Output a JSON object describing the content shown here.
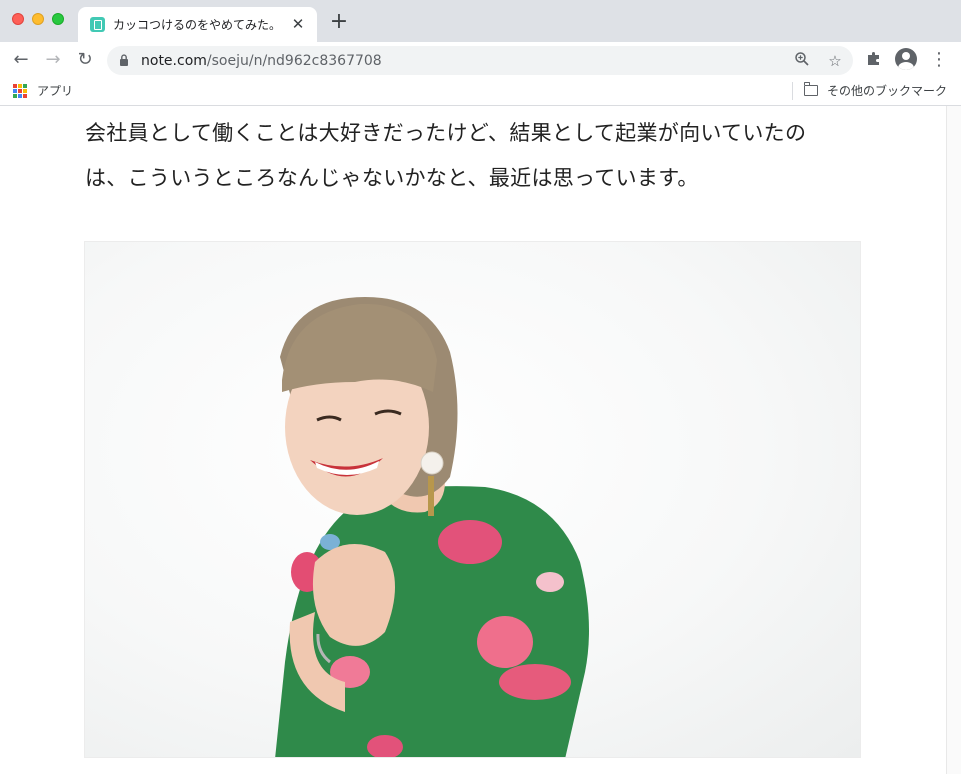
{
  "browser": {
    "tab_title": "カッコつけるのをやめてみた。",
    "tab_close": "✕",
    "new_tab": "+",
    "url_host": "note.com",
    "url_path": "/soeju/n/nd962c8367708",
    "back": "←",
    "forward": "→",
    "reload": "↻",
    "zoom": "⊕",
    "star": "☆",
    "extensions": "✚",
    "menu": "⋮"
  },
  "bookmarks": {
    "apps_label": "アプリ",
    "other_label": "その他のブックマーク"
  },
  "article": {
    "line1": "会社員として働くことは大好きだったけど、結果として起業が向いていたの",
    "line2": "は、こういうところなんじゃないかなと、最近は思っています。"
  },
  "colors": {
    "apps_grid": [
      "#ea4335",
      "#fbbc04",
      "#34a853",
      "#4285f4",
      "#ea4335",
      "#fbbc04",
      "#34a853",
      "#4285f4",
      "#ea4335"
    ],
    "favicon": "#41c9b4",
    "dress": "#2f8a4a"
  }
}
